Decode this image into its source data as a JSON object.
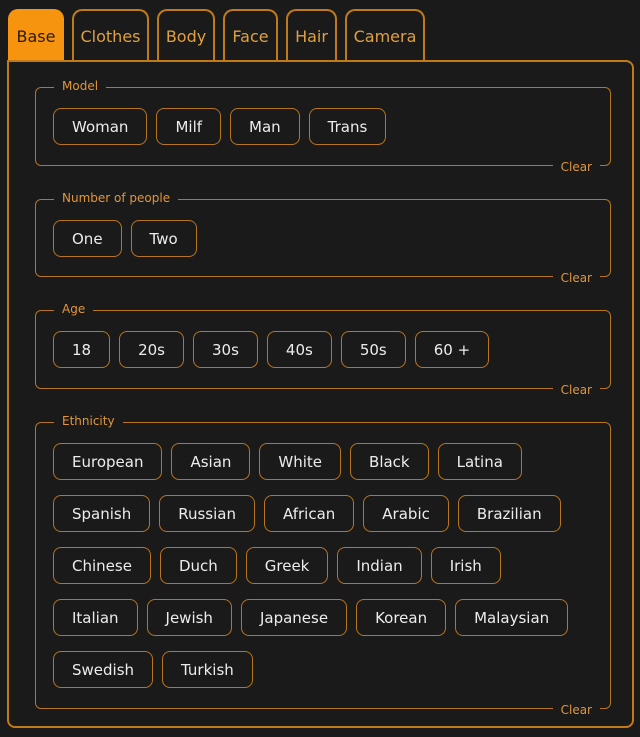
{
  "tabs": [
    {
      "label": "Base",
      "active": true
    },
    {
      "label": "Clothes",
      "active": false
    },
    {
      "label": "Body",
      "active": false
    },
    {
      "label": "Face",
      "active": false
    },
    {
      "label": "Hair",
      "active": false
    },
    {
      "label": "Camera",
      "active": false
    }
  ],
  "colors": {
    "accent": "#f7940f",
    "border": "#c07a1a",
    "background": "#1a1a1a",
    "text": "#ececec"
  },
  "clear_label": "Clear",
  "sections": {
    "model": {
      "legend": "Model",
      "options": [
        "Woman",
        "Milf",
        "Man",
        "Trans"
      ]
    },
    "people": {
      "legend": "Number of people",
      "options": [
        "One",
        "Two"
      ]
    },
    "age": {
      "legend": "Age",
      "options": [
        "18",
        "20s",
        "30s",
        "40s",
        "50s",
        "60 +"
      ]
    },
    "ethnicity": {
      "legend": "Ethnicity",
      "options": [
        "European",
        "Asian",
        "White",
        "Black",
        "Latina",
        "Spanish",
        "Russian",
        "African",
        "Arabic",
        "Brazilian",
        "Chinese",
        "Duch",
        "Greek",
        "Indian",
        "Irish",
        "Italian",
        "Jewish",
        "Japanese",
        "Korean",
        "Malaysian",
        "Swedish",
        "Turkish"
      ]
    }
  }
}
